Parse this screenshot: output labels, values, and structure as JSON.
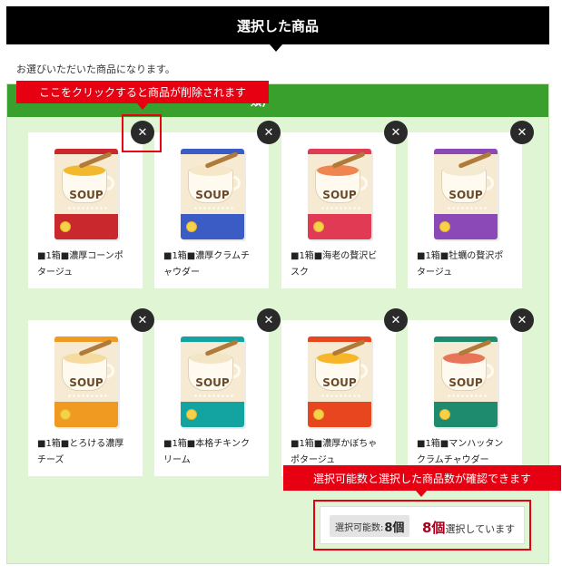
{
  "header": {
    "title": "選択した商品"
  },
  "intro": "お選びいただいた商品になります。",
  "panel": {
    "bar_visible_text": "類)"
  },
  "annotations": {
    "remove_hint": "ここをクリックすると商品が削除されます",
    "count_hint": "選択可能数と選択した商品数が確認できます"
  },
  "remove_symbol": "✕",
  "products": [
    {
      "name_line1": "■1箱■濃厚コーンポ",
      "name_line2": "タージュ",
      "box_text": "SOUP",
      "colors": {
        "top": "#c9282d",
        "bottom": "#c9282d",
        "soup": "#f2b92e"
      }
    },
    {
      "name_line1": "■1箱■濃厚クラムチ",
      "name_line2": "ャウダー",
      "box_text": "SOUP",
      "colors": {
        "top": "#3a5cc4",
        "bottom": "#3a5cc4",
        "soup": "#f5e7c8"
      }
    },
    {
      "name_line1": "■1箱■海老の贅沢ビ",
      "name_line2": "スク",
      "box_text": "SOUP",
      "colors": {
        "top": "#e03a55",
        "bottom": "#e03a55",
        "soup": "#ef8650"
      }
    },
    {
      "name_line1": "■1箱■牡蠣の贅沢ポ",
      "name_line2": "タージュ",
      "box_text": "SOUP",
      "colors": {
        "top": "#8b49b8",
        "bottom": "#8b49b8",
        "soup": "#f4ead2"
      }
    },
    {
      "name_line1": "■1箱■とろける濃厚",
      "name_line2": "チーズ",
      "box_text": "SOUP",
      "colors": {
        "top": "#f09a22",
        "bottom": "#f09a22",
        "soup": "#f5dba0"
      }
    },
    {
      "name_line1": "■1箱■本格チキンク",
      "name_line2": "リーム",
      "box_text": "SOUP",
      "colors": {
        "top": "#13a3a0",
        "bottom": "#13a3a0",
        "soup": "#f3e6c6"
      }
    },
    {
      "name_line1": "■1箱■濃厚かぼちゃ",
      "name_line2": "ポタージュ",
      "box_text": "SOUP",
      "colors": {
        "top": "#e8461e",
        "bottom": "#e8461e",
        "soup": "#f7b52a"
      }
    },
    {
      "name_line1": "■1箱■マンハッタン",
      "name_line2": "クラムチャウダー",
      "box_text": "SOUP",
      "colors": {
        "top": "#1e8a6e",
        "bottom": "#1e8a6e",
        "soup": "#e8745a"
      }
    }
  ],
  "summary": {
    "limit_label": "選択可能数:",
    "limit_value": "8個",
    "selected_count": "8個",
    "selected_suffix": "選択しています"
  }
}
